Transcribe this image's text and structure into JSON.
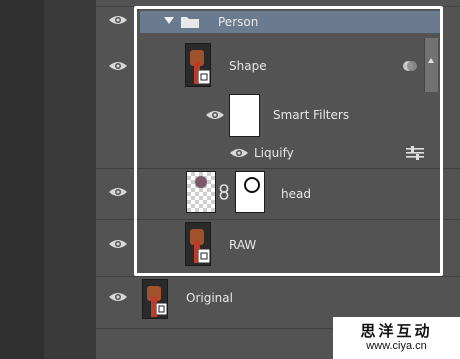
{
  "layers": {
    "group": {
      "name": "Person"
    },
    "shape": {
      "name": "Shape"
    },
    "smart_filters": {
      "name": "Smart Filters"
    },
    "liquify": {
      "name": "Liquify"
    },
    "head": {
      "name": "head"
    },
    "raw": {
      "name": "RAW"
    },
    "original": {
      "name": "Original"
    }
  },
  "watermark": {
    "line1": "思洋互动",
    "line2": "www.ciya.cn"
  },
  "colors": {
    "group_header": "#6a7b90",
    "panel": "#535353",
    "highlight": "#ffffff"
  }
}
